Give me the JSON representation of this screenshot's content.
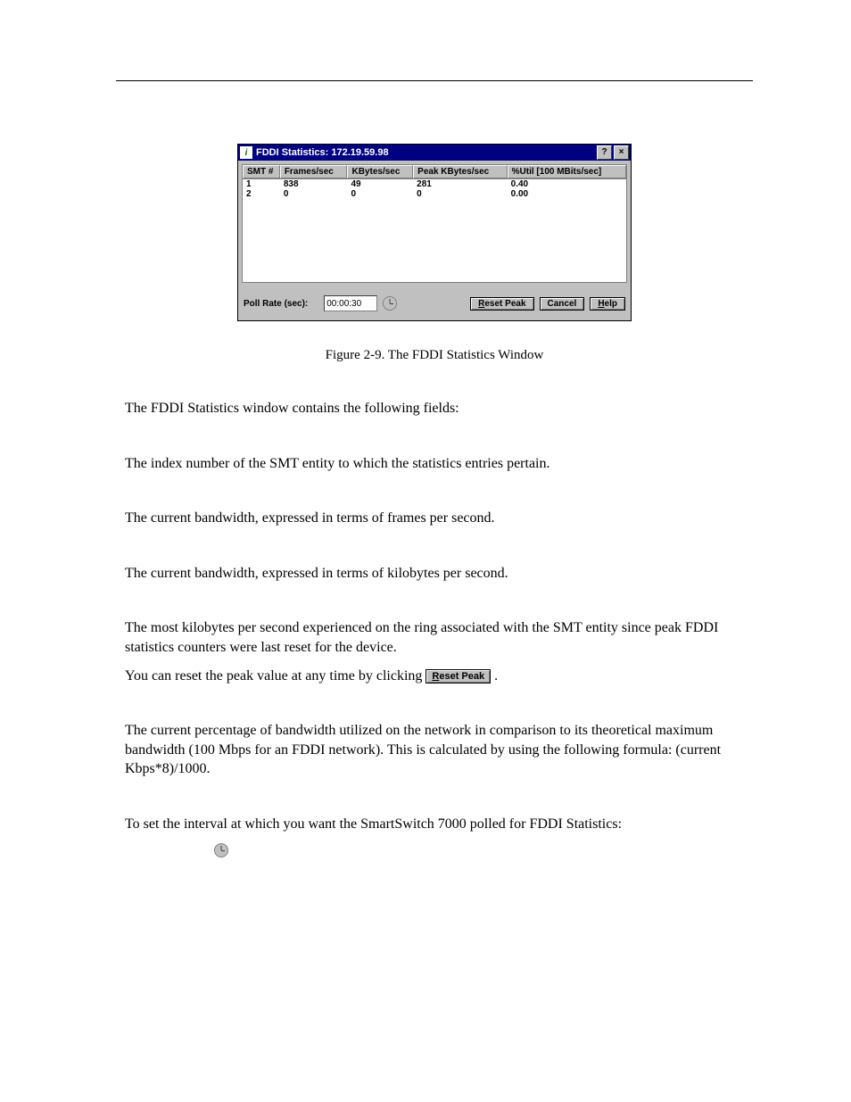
{
  "window": {
    "title": "FDDI Statistics: 172.19.59.98",
    "help_glyph": "?",
    "close_glyph": "×",
    "columns": {
      "smt": "SMT #",
      "fps": "Frames/sec",
      "kbps": "KBytes/sec",
      "peak": "Peak KBytes/sec",
      "util": "%Util [100 MBits/sec]"
    },
    "rows": [
      {
        "smt": "1",
        "fps": "838",
        "kbps": "49",
        "peak": "281",
        "util": "0.40"
      },
      {
        "smt": "2",
        "fps": "0",
        "kbps": "0",
        "peak": "0",
        "util": "0.00"
      }
    ],
    "poll_label": "Poll Rate (sec):",
    "poll_value": "00:00:30",
    "buttons": {
      "reset_peak": "Reset Peak",
      "cancel": "Cancel",
      "help": "Help"
    }
  },
  "caption": "Figure 2-9.  The FDDI Statistics Window",
  "text": {
    "intro": "The FDDI Statistics window contains the following fields:",
    "smt": "The index number of the SMT entity to which the statistics entries pertain.",
    "fps": "The current bandwidth, expressed in terms of frames per second.",
    "kbps": "The current bandwidth, expressed in terms of kilobytes per second.",
    "peak": "The most kilobytes per second experienced on the ring associated with the SMT entity since peak FDDI statistics counters were last reset for the device.",
    "peak_reset_pre": "You can reset the peak value at any time by clicking ",
    "peak_reset_btn": "Reset Peak",
    "peak_reset_post": ".",
    "util": "The current percentage of bandwidth utilized on the network in comparison to its theoretical maximum bandwidth (100 Mbps for an FDDI network). This is calculated by using the following formula: (current Kbps*8)/1000.",
    "poll": "To set the interval at which you want the SmartSwitch 7000 polled for FDDI Statistics:"
  }
}
